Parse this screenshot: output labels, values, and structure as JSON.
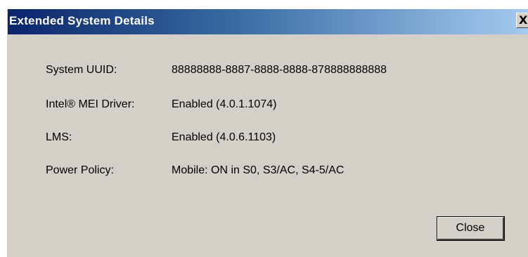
{
  "window": {
    "title": "Extended System Details",
    "close_glyph": "X"
  },
  "details": [
    {
      "label": "System UUID:",
      "value": "88888888-8887-8888-8888-878888888888"
    },
    {
      "label": "Intel® MEI Driver:",
      "value": "Enabled (4.0.1.1074)"
    },
    {
      "label": "LMS:",
      "value": "Enabled (4.0.6.1103)"
    },
    {
      "label": "Power Policy:",
      "value": "Mobile: ON in S0, S3/AC, S4-5/AC"
    }
  ],
  "buttons": {
    "close_label": "Close"
  },
  "colors": {
    "titlebar_start": "#0a246a",
    "titlebar_end": "#a6caf0",
    "dialog_background": "#d4d0c8"
  },
  "icons": {
    "title_close": "close-icon"
  }
}
